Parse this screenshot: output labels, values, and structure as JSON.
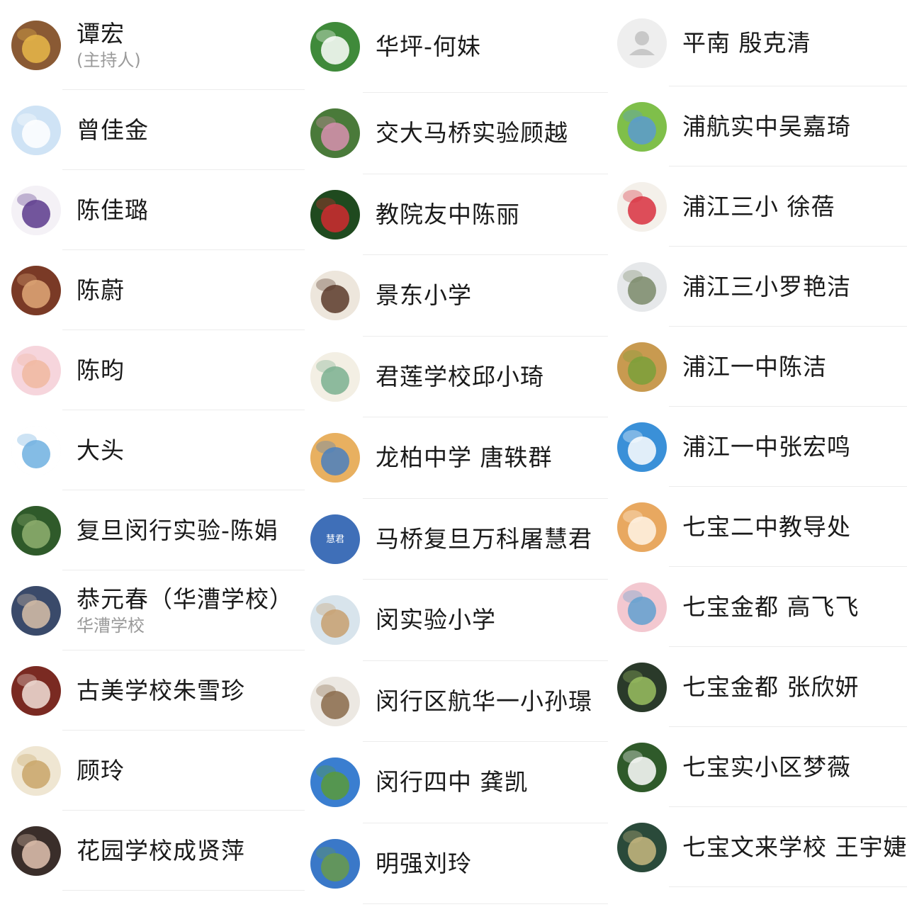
{
  "columns": [
    {
      "participants": [
        {
          "name": "谭宏",
          "subtitle": "(主持人)",
          "avatar_icon": "teddy-bear-avatar",
          "colors": [
            "#8a5a34",
            "#e8b84a"
          ]
        },
        {
          "name": "曾佳金",
          "avatar_icon": "cinnamoroll-avatar",
          "colors": [
            "#cfe3f5",
            "#ffffff"
          ]
        },
        {
          "name": "陈佳璐",
          "avatar_icon": "eiffel-tower-avatar",
          "colors": [
            "#f4f1f6",
            "#5b3a8c"
          ]
        },
        {
          "name": "陈蔚",
          "avatar_icon": "doll-girl-avatar",
          "colors": [
            "#7a3a26",
            "#e0a878"
          ]
        },
        {
          "name": "陈昀",
          "avatar_icon": "baby-photo-avatar",
          "colors": [
            "#f6d5dc",
            "#f0b8a0"
          ]
        },
        {
          "name": "大头",
          "avatar_icon": "cartoon-boy-avatar",
          "colors": [
            "#ffffff",
            "#6fb0e0"
          ]
        },
        {
          "name": "复旦闵行实验-陈娟",
          "avatar_icon": "pond-landscape-avatar",
          "colors": [
            "#2f5a2a",
            "#8fb070"
          ]
        },
        {
          "name": "恭元春（华漕学校）",
          "subtitle": "华漕学校",
          "avatar_icon": "man-portrait-avatar",
          "colors": [
            "#3a4a6a",
            "#d8c0a8"
          ]
        },
        {
          "name": "古美学校朱雪珍",
          "avatar_icon": "hands-photo-avatar",
          "colors": [
            "#7a2a22",
            "#f2e0d8"
          ]
        },
        {
          "name": "顾玲",
          "avatar_icon": "plush-dog-avatar",
          "colors": [
            "#efe6d2",
            "#c9a56a"
          ]
        },
        {
          "name": "花园学校成贤萍",
          "avatar_icon": "child-photo-avatar",
          "colors": [
            "#3a2e2a",
            "#e2c2b0"
          ]
        }
      ]
    },
    {
      "participants": [
        {
          "name": "华坪-何妹",
          "avatar_icon": "white-flower-avatar",
          "colors": [
            "#3f8a3a",
            "#ffffff"
          ]
        },
        {
          "name": "交大马桥实验顾越",
          "avatar_icon": "garden-photo-avatar",
          "colors": [
            "#4a7a3a",
            "#d890b0"
          ]
        },
        {
          "name": "教院友中陈丽",
          "avatar_icon": "red-flower-avatar",
          "colors": [
            "#1f4a1f",
            "#d02a30"
          ]
        },
        {
          "name": "景东小学",
          "avatar_icon": "branch-plate-avatar",
          "colors": [
            "#ede6dc",
            "#5a3a2a"
          ]
        },
        {
          "name": "君莲学校邱小琦",
          "avatar_icon": "clover-drawing-avatar",
          "colors": [
            "#f3efe4",
            "#7ab090"
          ]
        },
        {
          "name": "龙柏中学 唐轶群",
          "avatar_icon": "figurine-avatar",
          "colors": [
            "#e8b060",
            "#4a80c0"
          ]
        },
        {
          "name": "马桥复旦万科屠慧君",
          "avatar_text": "慧君",
          "avatar_icon": "text-avatar",
          "colors": [
            "#3f6fb8",
            "#ffffff"
          ]
        },
        {
          "name": "闵实验小学",
          "avatar_icon": "straw-hat-avatar",
          "colors": [
            "#d8e4ec",
            "#c8a070"
          ]
        },
        {
          "name": "闵行区航华一小孙璟",
          "avatar_icon": "woman-standing-avatar",
          "colors": [
            "#ece8e2",
            "#8a6a4a"
          ]
        },
        {
          "name": "闵行四中 龚凯",
          "avatar_icon": "grassland-sky-avatar",
          "colors": [
            "#3a7ed0",
            "#5a9a3a"
          ]
        },
        {
          "name": "明强刘玲",
          "avatar_icon": "blue-sky-avatar",
          "colors": [
            "#3a78c8",
            "#6a9a4a"
          ]
        }
      ]
    },
    {
      "participants": [
        {
          "name": "平南 殷克清",
          "avatar_icon": "default-user-avatar",
          "colors": [
            "#eeeeee",
            "#c8c8c8"
          ]
        },
        {
          "name": "浦航实中吴嘉琦",
          "avatar_icon": "meadow-avatar",
          "colors": [
            "#7fbf4a",
            "#5a9ad0"
          ]
        },
        {
          "name": "浦江三小 徐蓓",
          "avatar_icon": "dog-with-rose-avatar",
          "colors": [
            "#f4f0ea",
            "#d83040"
          ]
        },
        {
          "name": "浦江三小罗艳洁",
          "avatar_icon": "blossom-branch-avatar",
          "colors": [
            "#e6e8ea",
            "#7a8a6a"
          ]
        },
        {
          "name": "浦江一中陈洁",
          "avatar_icon": "tea-cup-avatar",
          "colors": [
            "#c89a50",
            "#7aa03a"
          ]
        },
        {
          "name": "浦江一中张宏鸣",
          "avatar_icon": "cloud-sky-avatar",
          "colors": [
            "#3a90d8",
            "#ffffff"
          ]
        },
        {
          "name": "七宝二中教导处",
          "avatar_icon": "pomeranian-avatar",
          "colors": [
            "#e8a860",
            "#fff4e6"
          ]
        },
        {
          "name": "七宝金都 高飞飞",
          "avatar_icon": "sticker-collage-avatar",
          "colors": [
            "#f3c8d0",
            "#60a0d0"
          ]
        },
        {
          "name": "七宝金都 张欣妍",
          "avatar_icon": "zen-stones-avatar",
          "colors": [
            "#2a3a2a",
            "#9ac060"
          ]
        },
        {
          "name": "七宝实小区梦薇",
          "avatar_icon": "white-flowers-avatar",
          "colors": [
            "#2f5a2a",
            "#ffffff"
          ]
        },
        {
          "name": "七宝文来学校 王宇婕",
          "avatar_icon": "pond-painting-avatar",
          "colors": [
            "#2a4a3a",
            "#c8b880"
          ]
        }
      ]
    }
  ]
}
